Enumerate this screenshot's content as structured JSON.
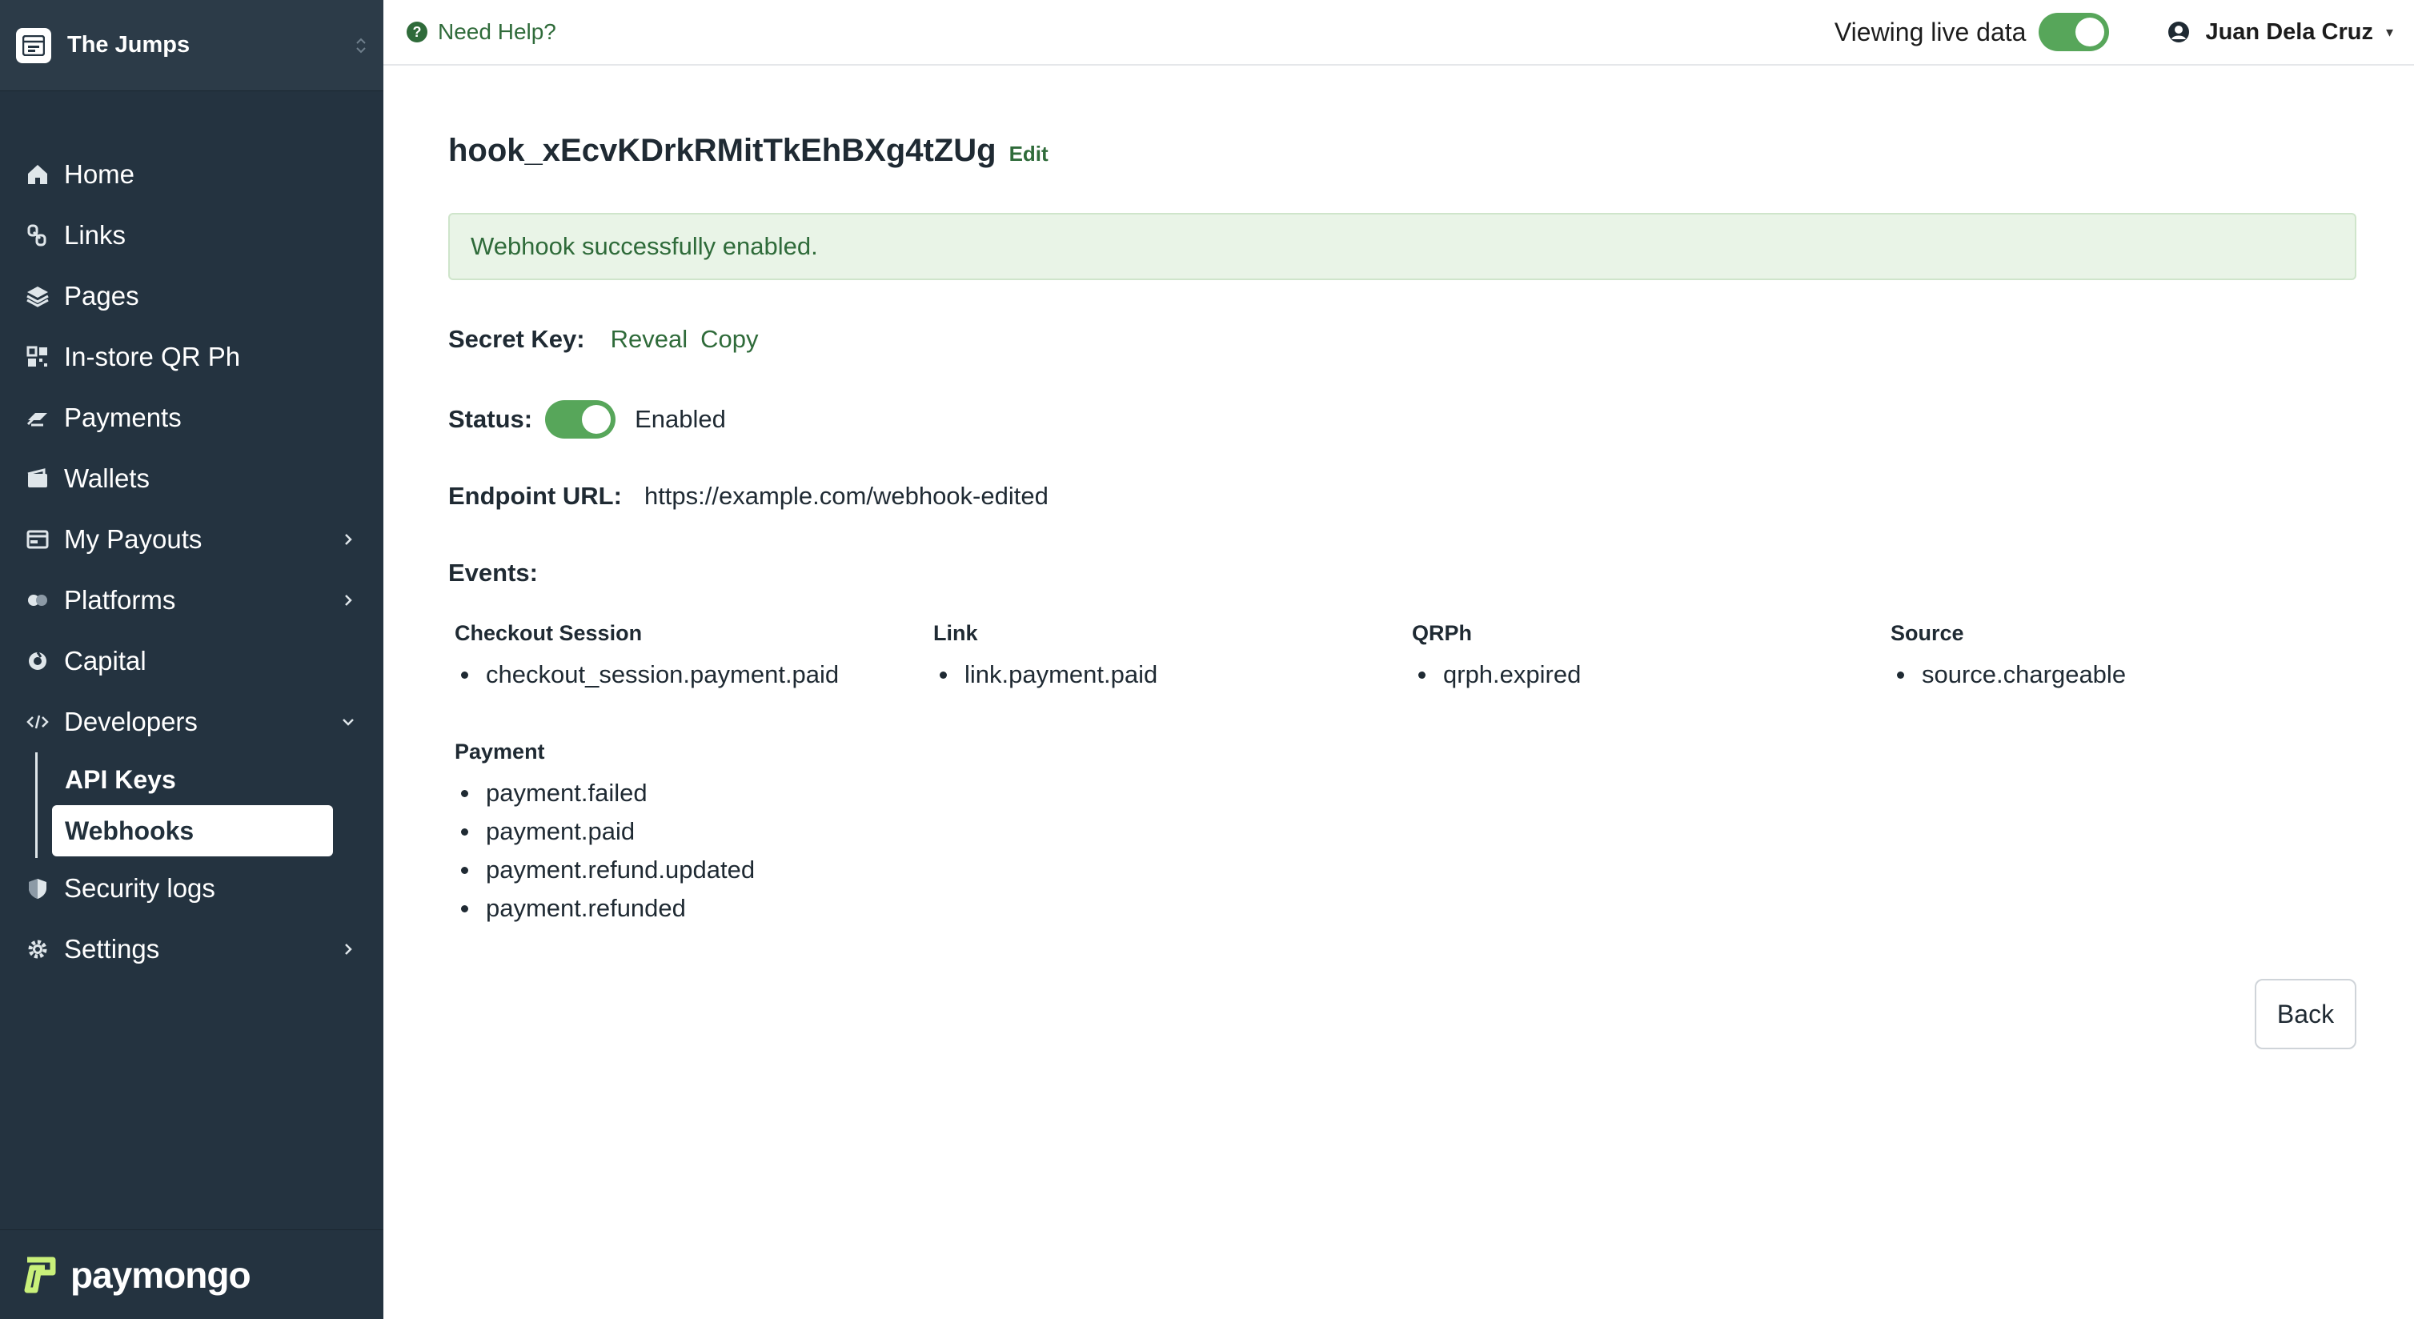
{
  "org": {
    "name": "The Jumps"
  },
  "nav": {
    "items": [
      {
        "label": "Home",
        "icon": "home-icon"
      },
      {
        "label": "Links",
        "icon": "links-icon"
      },
      {
        "label": "Pages",
        "icon": "pages-icon"
      },
      {
        "label": "In-store QR Ph",
        "icon": "qr-icon"
      },
      {
        "label": "Payments",
        "icon": "payments-icon"
      },
      {
        "label": "Wallets",
        "icon": "wallet-icon"
      },
      {
        "label": "My Payouts",
        "icon": "payouts-icon"
      },
      {
        "label": "Platforms",
        "icon": "platforms-icon"
      },
      {
        "label": "Capital",
        "icon": "capital-icon"
      },
      {
        "label": "Developers",
        "icon": "code-icon"
      },
      {
        "label": "Security logs",
        "icon": "shield-icon"
      },
      {
        "label": "Settings",
        "icon": "gear-icon"
      }
    ],
    "developers_sub": [
      {
        "label": "API Keys"
      },
      {
        "label": "Webhooks",
        "active": true
      }
    ]
  },
  "brand": {
    "name": "paymongo"
  },
  "topbar": {
    "help": "Need Help?",
    "live_label": "Viewing live data",
    "user": "Juan Dela Cruz"
  },
  "webhook": {
    "id": "hook_xEcvKDrkRMitTkEhBXg4tZUg",
    "edit": "Edit",
    "alert": "Webhook successfully enabled.",
    "secret_label": "Secret Key:",
    "reveal": "Reveal",
    "copy": "Copy",
    "status_label": "Status:",
    "status_value": "Enabled",
    "endpoint_label": "Endpoint URL:",
    "endpoint_value": "https://example.com/webhook-edited",
    "events_label": "Events:",
    "groups": [
      {
        "title": "Checkout Session",
        "events": [
          "checkout_session.payment.paid"
        ]
      },
      {
        "title": "Link",
        "events": [
          "link.payment.paid"
        ]
      },
      {
        "title": "QRPh",
        "events": [
          "qrph.expired"
        ]
      },
      {
        "title": "Source",
        "events": [
          "source.chargeable"
        ]
      },
      {
        "title": "Payment",
        "events": [
          "payment.failed",
          "payment.paid",
          "payment.refund.updated",
          "payment.refunded"
        ]
      }
    ],
    "back": "Back"
  },
  "colors": {
    "sidebar": "#243340",
    "accent": "#2f6b3a",
    "toggle": "#57a65a",
    "alert_bg": "#e9f4e7"
  }
}
